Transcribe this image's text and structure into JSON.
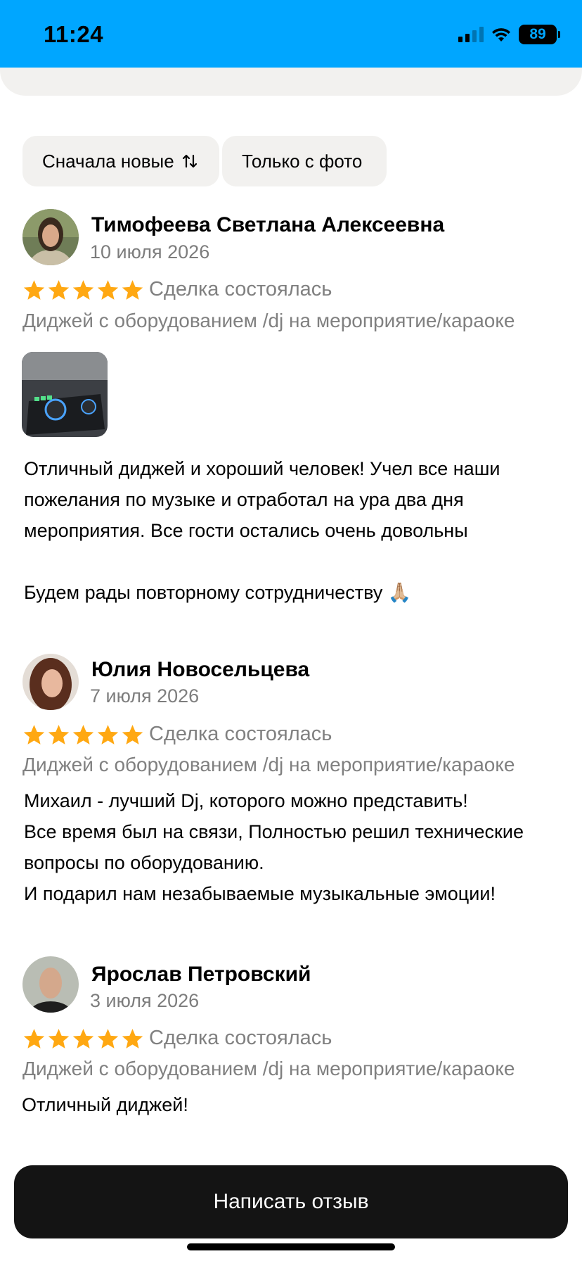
{
  "status_bar": {
    "time": "11:24",
    "battery": "89",
    "icons": [
      "signal-icon",
      "wifi-icon",
      "battery-icon"
    ]
  },
  "filters": {
    "sort_label": "Сначала новые",
    "sort_icon": "sort-arrows-icon",
    "photo_label": "Только с фото"
  },
  "reviews": [
    {
      "author": "Тимофеева Светлана Алексеевна",
      "date": "10 июля 2026",
      "rating": 5,
      "deal_status": "Сделка состоялась",
      "service": "Диджей с оборудованием /dj на мероприятие/караоке",
      "has_photo": true,
      "text": "Отличный диджей  и хороший человек! Учел все наши пожелания по музыке и отработал на ура два дня мероприятия. Все гости остались очень довольны\n\nБудем рады повторному сотрудничеству 🙏🏼"
    },
    {
      "author": "Юлия Новосельцева",
      "date": "7 июля 2026",
      "rating": 5,
      "deal_status": "Сделка состоялась",
      "service": "Диджей с оборудованием /dj на мероприятие/караоке",
      "text": "Михаил - лучший Dj, которого можно представить!\nВсе время был на связи, Полностью решил технические вопросы по оборудованию.\nИ подарил нам незабываемые музыкальные эмоции!"
    },
    {
      "author": "Ярослав Петровский",
      "date": "3 июля 2026",
      "rating": 5,
      "deal_status": "Сделка состоялась",
      "service": "Диджей с оборудованием /dj на мероприятие/караоке",
      "text": "Отличный диджей!"
    }
  ],
  "colors": {
    "accent": "#00a6ff",
    "star": "#ffa812",
    "button_bg": "#141414"
  },
  "footer": {
    "write_review_label": "Написать отзыв"
  }
}
